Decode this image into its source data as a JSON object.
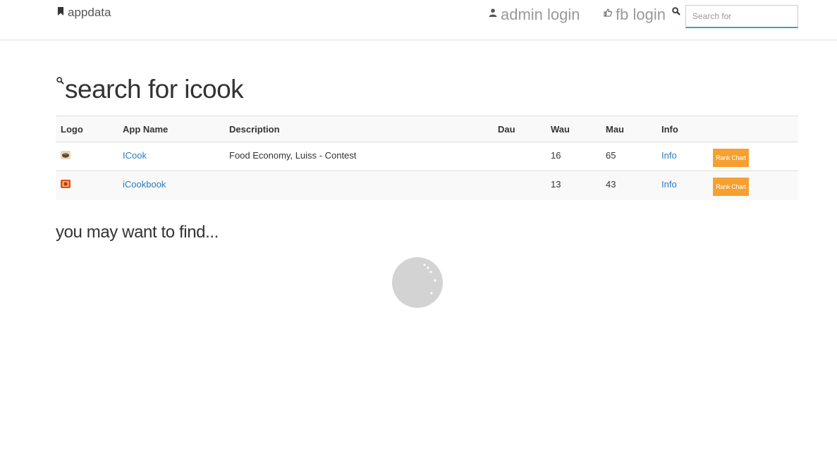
{
  "nav": {
    "brand": "appdata",
    "admin_login": "admin login",
    "fb_login": "fb login",
    "search_placeholder": "Search for"
  },
  "page": {
    "title": "search for icook",
    "subtitle": "you may want to find..."
  },
  "table": {
    "headers": {
      "logo": "Logo",
      "app_name": "App Name",
      "description": "Description",
      "dau": "Dau",
      "wau": "Wau",
      "mau": "Mau",
      "info": "Info"
    },
    "rows": [
      {
        "app_name": "ICook",
        "description": "Food Economy, Luiss - Contest",
        "dau": "",
        "wau": "16",
        "mau": "65",
        "info": "Info",
        "action": "Rank Chart"
      },
      {
        "app_name": "iCookbook",
        "description": "",
        "dau": "",
        "wau": "13",
        "mau": "43",
        "info": "Info",
        "action": "Rank Chart"
      }
    ]
  },
  "colors": {
    "link": "#2a7ac0",
    "button": "#f5a030",
    "search_underline": "#3aa2b9",
    "spinner": "#d3d3d3"
  },
  "icons": {
    "brand": "bookmark-icon",
    "admin": "user-icon",
    "fb": "thumbs-up-icon",
    "search": "search-icon"
  }
}
